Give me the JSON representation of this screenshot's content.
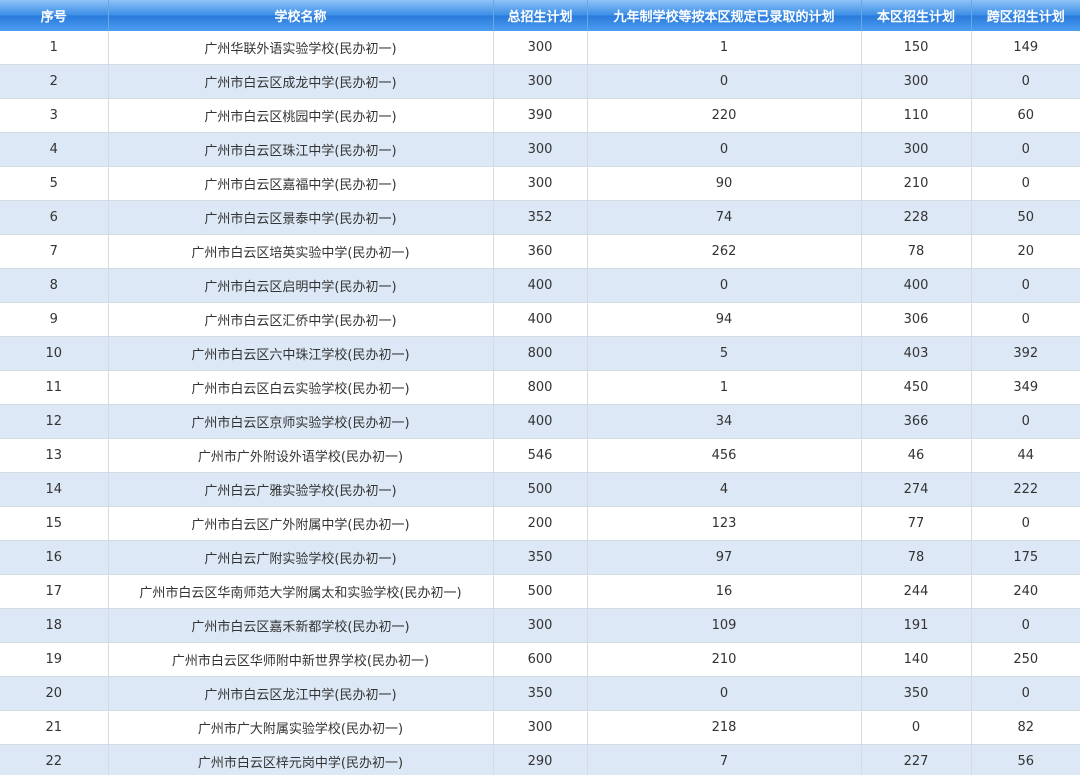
{
  "table": {
    "columns": [
      "序号",
      "学校名称",
      "总招生计划",
      "九年制学校等按本区规定已录取的计划",
      "本区招生计划",
      "跨区招生计划"
    ],
    "rows": [
      [
        "1",
        "广州华联外语实验学校(民办初一)",
        "300",
        "1",
        "150",
        "149"
      ],
      [
        "2",
        "广州市白云区成龙中学(民办初一)",
        "300",
        "0",
        "300",
        "0"
      ],
      [
        "3",
        "广州市白云区桃园中学(民办初一)",
        "390",
        "220",
        "110",
        "60"
      ],
      [
        "4",
        "广州市白云区珠江中学(民办初一)",
        "300",
        "0",
        "300",
        "0"
      ],
      [
        "5",
        "广州市白云区嘉福中学(民办初一)",
        "300",
        "90",
        "210",
        "0"
      ],
      [
        "6",
        "广州市白云区景泰中学(民办初一)",
        "352",
        "74",
        "228",
        "50"
      ],
      [
        "7",
        "广州市白云区培英实验中学(民办初一)",
        "360",
        "262",
        "78",
        "20"
      ],
      [
        "8",
        "广州市白云区启明中学(民办初一)",
        "400",
        "0",
        "400",
        "0"
      ],
      [
        "9",
        "广州市白云区汇侨中学(民办初一)",
        "400",
        "94",
        "306",
        "0"
      ],
      [
        "10",
        "广州市白云区六中珠江学校(民办初一)",
        "800",
        "5",
        "403",
        "392"
      ],
      [
        "11",
        "广州市白云区白云实验学校(民办初一)",
        "800",
        "1",
        "450",
        "349"
      ],
      [
        "12",
        "广州市白云区京师实验学校(民办初一)",
        "400",
        "34",
        "366",
        "0"
      ],
      [
        "13",
        "广州市广外附设外语学校(民办初一)",
        "546",
        "456",
        "46",
        "44"
      ],
      [
        "14",
        "广州白云广雅实验学校(民办初一)",
        "500",
        "4",
        "274",
        "222"
      ],
      [
        "15",
        "广州市白云区广外附属中学(民办初一)",
        "200",
        "123",
        "77",
        "0"
      ],
      [
        "16",
        "广州白云广附实验学校(民办初一)",
        "350",
        "97",
        "78",
        "175"
      ],
      [
        "17",
        "广州市白云区华南师范大学附属太和实验学校(民办初一)",
        "500",
        "16",
        "244",
        "240"
      ],
      [
        "18",
        "广州市白云区嘉禾新都学校(民办初一)",
        "300",
        "109",
        "191",
        "0"
      ],
      [
        "19",
        "广州市白云区华师附中新世界学校(民办初一)",
        "600",
        "210",
        "140",
        "250"
      ],
      [
        "20",
        "广州市白云区龙江中学(民办初一)",
        "350",
        "0",
        "350",
        "0"
      ],
      [
        "21",
        "广州市广大附属实验学校(民办初一)",
        "300",
        "218",
        "0",
        "82"
      ],
      [
        "22",
        "广州市白云区梓元岗中学(民办初一)",
        "290",
        "7",
        "227",
        "56"
      ]
    ]
  }
}
